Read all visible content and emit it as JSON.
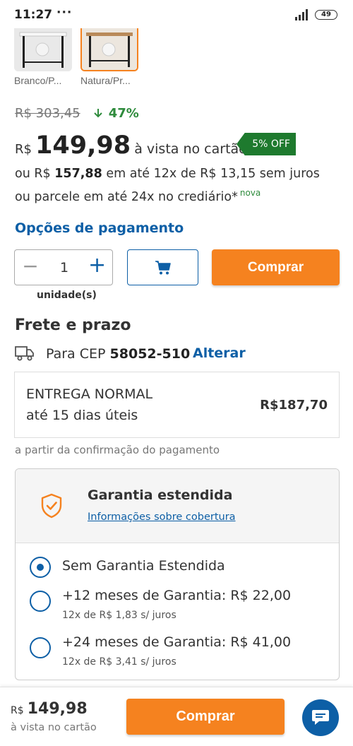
{
  "status_bar": {
    "time": "11:27",
    "dots": "···",
    "battery": "49",
    "signal_icon": "signal-icon",
    "battery_icon": "battery-icon"
  },
  "variants": [
    {
      "label": "Branco/P...",
      "selected": false
    },
    {
      "label": "Natura/Pr...",
      "selected": true
    }
  ],
  "pricing": {
    "old_price": "R$ 303,45",
    "discount": "47%",
    "discount_icon": "arrow-down-icon",
    "currency": "R$",
    "price": "149,98",
    "vista": "à vista no cartão",
    "off_badge": "5% OFF",
    "install_prefix": "ou R$",
    "install_total": "157,88",
    "install_suffix": "em até 12x de R$ 13,15 sem juros",
    "crediario": "ou parcele em até 24x no crediário*",
    "nova": "nova"
  },
  "payment_options_label": "Opções de pagamento",
  "quantity": {
    "value": "1",
    "unit": "unidade(s)",
    "minus": "−",
    "plus": "+"
  },
  "cart_button_icon": "cart-icon",
  "buy_label": "Comprar",
  "frete": {
    "title": "Frete e prazo",
    "cep_prefix": "Para CEP",
    "cep": "58052-510",
    "alterar": "Alterar",
    "truck_icon": "truck-icon",
    "entrega_type": "ENTREGA NORMAL",
    "entrega_days": "até 15 dias úteis",
    "entrega_price": "R$187,70",
    "note": "a partir da confirmação do pagamento"
  },
  "garantia": {
    "title": "Garantia estendida",
    "link": "Informações sobre cobertura",
    "icon": "shield-icon",
    "options": [
      {
        "label": "Sem Garantia Estendida",
        "sub": "",
        "checked": true
      },
      {
        "label": "+12 meses de Garantia: R$ 22,00",
        "sub": "12x de R$ 1,83 s/ juros",
        "checked": false
      },
      {
        "label": "+24 meses de Garantia: R$ 41,00",
        "sub": "12x de R$ 3,41 s/ juros",
        "checked": false
      }
    ]
  },
  "bottom_bar": {
    "currency": "R$",
    "price": "149,98",
    "vista": "à vista no cartão",
    "buy_label": "Comprar",
    "chat_icon": "chat-icon"
  },
  "colors": {
    "accent": "#f5821f",
    "brand_blue": "#0d5fa6",
    "discount_green": "#2e8b3c",
    "badge_green": "#1e7a2e"
  }
}
